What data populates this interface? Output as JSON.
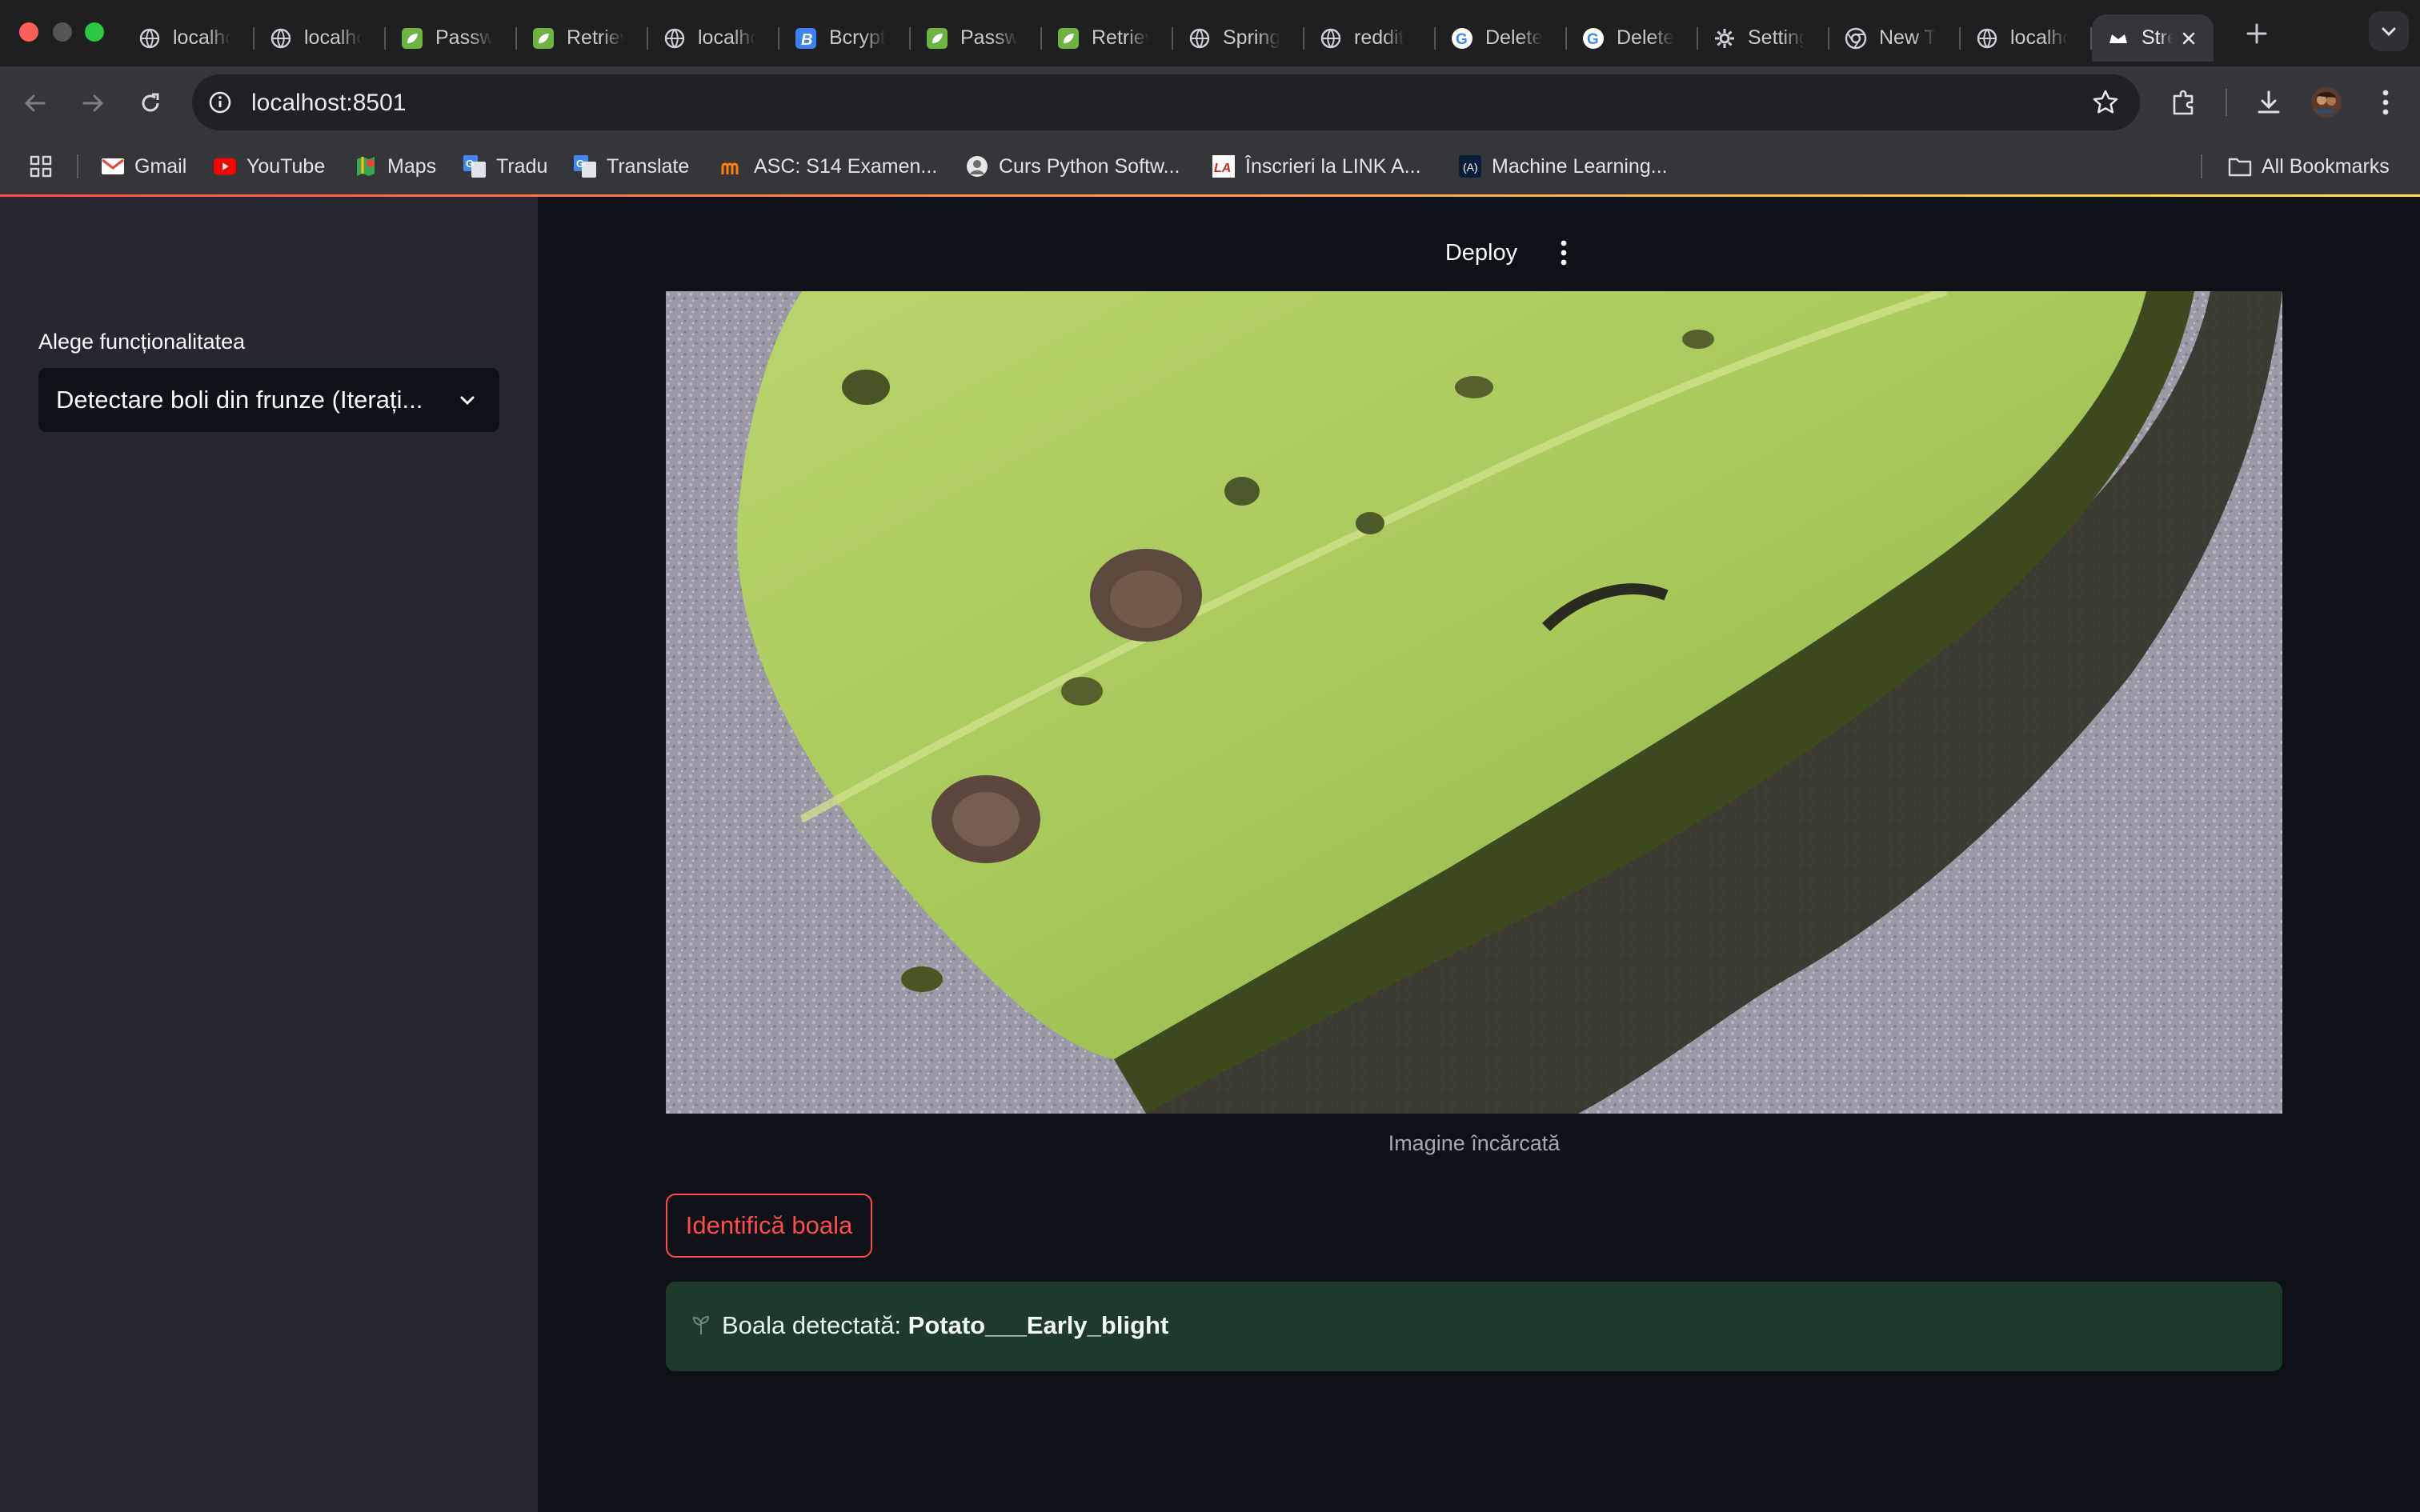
{
  "browser": {
    "tabs": [
      {
        "title": "localhost",
        "icon": "globe-icon"
      },
      {
        "title": "localhost",
        "icon": "globe-icon"
      },
      {
        "title": "Password",
        "icon": "spring-leaf-icon"
      },
      {
        "title": "Retrieve",
        "icon": "spring-leaf-icon"
      },
      {
        "title": "localhost",
        "icon": "globe-icon"
      },
      {
        "title": "Bcrypt",
        "icon": "bcrypt-b-icon"
      },
      {
        "title": "Password",
        "icon": "spring-leaf-icon"
      },
      {
        "title": "Retrieve",
        "icon": "spring-leaf-icon"
      },
      {
        "title": "Spring",
        "icon": "globe-icon"
      },
      {
        "title": "reddit",
        "icon": "globe-icon"
      },
      {
        "title": "Delete",
        "icon": "google-g-icon"
      },
      {
        "title": "Delete",
        "icon": "google-g-icon"
      },
      {
        "title": "Settings",
        "icon": "gear-icon"
      },
      {
        "title": "New Tab",
        "icon": "chrome-icon"
      },
      {
        "title": "localhost",
        "icon": "globe-icon"
      }
    ],
    "active_tab": {
      "title": "Streamlit",
      "icon": "streamlit-crown-icon"
    },
    "url": "localhost:8501",
    "bookmarks": [
      {
        "label": "Gmail",
        "icon": "gmail-icon"
      },
      {
        "label": "YouTube",
        "icon": "youtube-icon"
      },
      {
        "label": "Maps",
        "icon": "maps-icon"
      },
      {
        "label": "Tradu",
        "icon": "google-translate-icon"
      },
      {
        "label": "Translate",
        "icon": "google-translate-icon"
      },
      {
        "label": "ASC: S14 Examen...",
        "icon": "moodle-icon"
      },
      {
        "label": "Curs Python Softw...",
        "icon": "python-course-icon"
      },
      {
        "label": "Înscrieri la LINK A...",
        "icon": "link-academy-icon"
      },
      {
        "label": "Machine Learning...",
        "icon": "ml-course-icon"
      }
    ],
    "all_bookmarks_label": "All Bookmarks"
  },
  "app": {
    "deploy_label": "Deploy",
    "sidebar": {
      "select_label": "Alege funcționalitatea",
      "select_value": "Detectare boli din frunze (Iterați..."
    },
    "main": {
      "image_caption": "Imagine încărcată",
      "identify_button": "Identifică boala",
      "result_prefix": "Boala detectată: ",
      "result_value": "Potato___Early_blight",
      "result_icon": "plant-icon"
    }
  },
  "colors": {
    "accent": "#ff4b4b",
    "success_bg": "#1f3a2a",
    "sidebar_bg": "#262730",
    "main_bg": "#0e1117"
  }
}
